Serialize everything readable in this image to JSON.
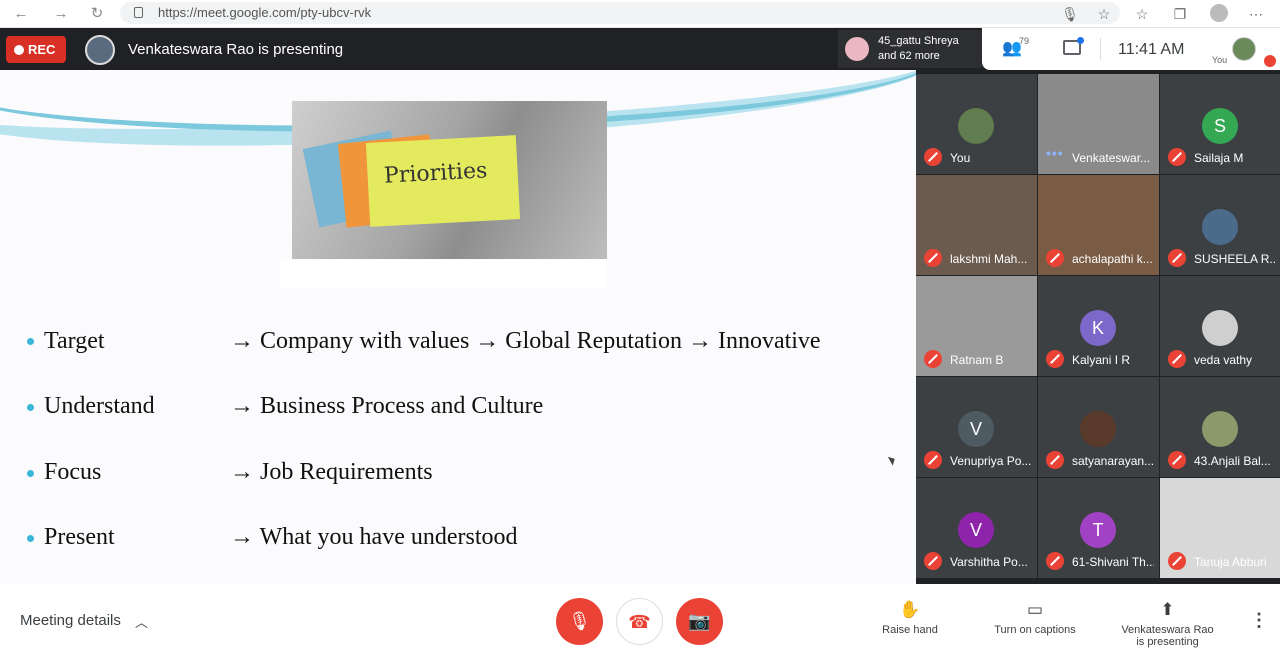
{
  "browser": {
    "url": "https://meet.google.com/pty-ubcv-rvk",
    "back_icon": "arrow-left-icon",
    "reload_icon": "reload-icon"
  },
  "topbar": {
    "rec_label": "REC",
    "presenting_text": "Venkateswara Rao is presenting",
    "participant_tile_name": "45_gattu Shreya",
    "participant_tile_more": "and 62 more",
    "people_count": "79",
    "time": "11:41 AM",
    "you_label": "You"
  },
  "slide": {
    "photo_text": "Priorities",
    "items": [
      {
        "term": "Target",
        "desc": "→ Company with values → Global Reputation → Innovative"
      },
      {
        "term": "Understand",
        "desc": "→ Business Process and Culture"
      },
      {
        "term": "Focus",
        "desc": "→ Job Requirements"
      },
      {
        "term": "Present",
        "desc": "→ What you have understood"
      }
    ]
  },
  "participants": [
    {
      "name": "You",
      "initial": "",
      "color": "#5f7d4e"
    },
    {
      "name": "Venkateswar...",
      "initial": "",
      "color": "#8a8a8a"
    },
    {
      "name": "Sailaja M",
      "initial": "S",
      "color": "#34a853"
    },
    {
      "name": "lakshmi Mah...",
      "initial": "",
      "color": "#6b5a4e"
    },
    {
      "name": "achalapathi k...",
      "initial": "",
      "color": "#7a5c45"
    },
    {
      "name": "SUSHEELA R...",
      "initial": "",
      "color": "#4a6b8a"
    },
    {
      "name": "Ratnam B",
      "initial": "",
      "color": "#9a9a9a"
    },
    {
      "name": "Kalyani I R",
      "initial": "K",
      "color": "#7b68c9"
    },
    {
      "name": "veda vathy",
      "initial": "",
      "color": "#cfcfcf"
    },
    {
      "name": "Venupriya Po...",
      "initial": "V",
      "color": "#4f5b62"
    },
    {
      "name": "satyanarayan...",
      "initial": "",
      "color": "#5a3a2a"
    },
    {
      "name": "43.Anjali Bal...",
      "initial": "",
      "color": "#8a9a6a"
    },
    {
      "name": "Varshitha Po...",
      "initial": "V",
      "color": "#8e24aa"
    },
    {
      "name": "61-Shivani Th...",
      "initial": "T",
      "color": "#a142c4"
    },
    {
      "name": "Tanuja Abburi",
      "initial": "",
      "color": "#d8d8d8"
    }
  ],
  "controls": {
    "meeting_details": "Meeting details",
    "raise_hand": "Raise hand",
    "captions": "Turn on captions",
    "presenting_line1": "Venkateswara Rao",
    "presenting_line2": "is presenting"
  }
}
